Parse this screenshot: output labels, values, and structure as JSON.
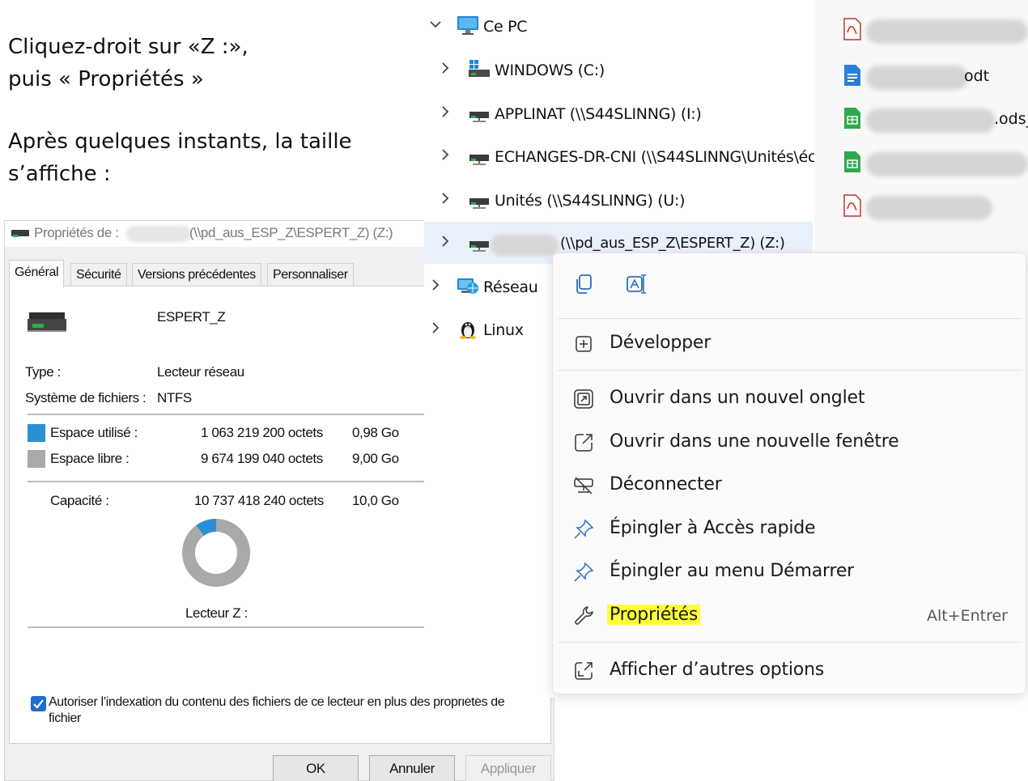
{
  "instructions": {
    "line1": "Cliquez-droit sur «Z :»,",
    "line2": "puis « Propriétés »",
    "line3": "Après quelques instants, la taille",
    "line4": "s’affiche :"
  },
  "dialog": {
    "title_prefix": "Propriétés de :",
    "title_suffix": "(\\\\pd_aus_ESP_Z\\ESPERT_Z) (Z:)",
    "tabs": [
      "Général",
      "Sécurité",
      "Versions précédentes",
      "Personnaliser"
    ],
    "drive_name": "ESPERT_Z",
    "type_label": "Type :",
    "type_value": "Lecteur réseau",
    "fs_label": "Système de fichiers :",
    "fs_value": "NTFS",
    "used_label": "Espace utilisé :",
    "used_bytes": "1 063 219 200 octets",
    "used_size": "0,98 Go",
    "free_label": "Espace libre :",
    "free_bytes": "9 674 199 040 octets",
    "free_size": "9,00 Go",
    "capacity_label": "Capacité :",
    "capacity_bytes": "10 737 418 240 octets",
    "capacity_size": "10,0 Go",
    "used_fraction": 0.099,
    "drive_label": "Lecteur Z :",
    "index_line1": "Autoriser l’indexation du contenu des fichiers de ce lecteur en plus des propriétés de",
    "index_line2": "fichier",
    "ok": "OK",
    "cancel": "Annuler",
    "apply": "Appliquer",
    "colors": {
      "used": "#2b8fd6",
      "free": "#a9a9a9"
    }
  },
  "nav": {
    "items": [
      {
        "label": "Ce PC"
      },
      {
        "label": "WINDOWS (C:)"
      },
      {
        "label": "APPLINAT (\\\\S44SLINNG) (I:)"
      },
      {
        "label": "ECHANGES-DR-CNI (\\\\S44SLINNG\\Unités\\éc"
      },
      {
        "label": "Unités (\\\\S44SLINNG) (U:)"
      },
      {
        "label": "(\\\\pd_aus_ESP_Z\\ESPERT_Z) (Z:)"
      },
      {
        "label": "Réseau"
      },
      {
        "label": "Linux"
      }
    ]
  },
  "files": {
    "items": [
      {
        "suffix": ""
      },
      {
        "suffix": "odt"
      },
      {
        "suffix": ".ods_"
      },
      {
        "suffix": ""
      },
      {
        "suffix": ""
      }
    ]
  },
  "context_menu": {
    "expand": "Développer",
    "open_tab": "Ouvrir dans un nouvel onglet",
    "open_window": "Ouvrir dans une nouvelle fenêtre",
    "disconnect": "Déconnecter",
    "pin_quick": "Épingler à Accès rapide",
    "pin_start": "Épingler au menu Démarrer",
    "properties": "Propriétés",
    "properties_shortcut": "Alt+Entrer",
    "more_options": "Afficher d’autres options",
    "highlight_color": "#ffff3a"
  }
}
